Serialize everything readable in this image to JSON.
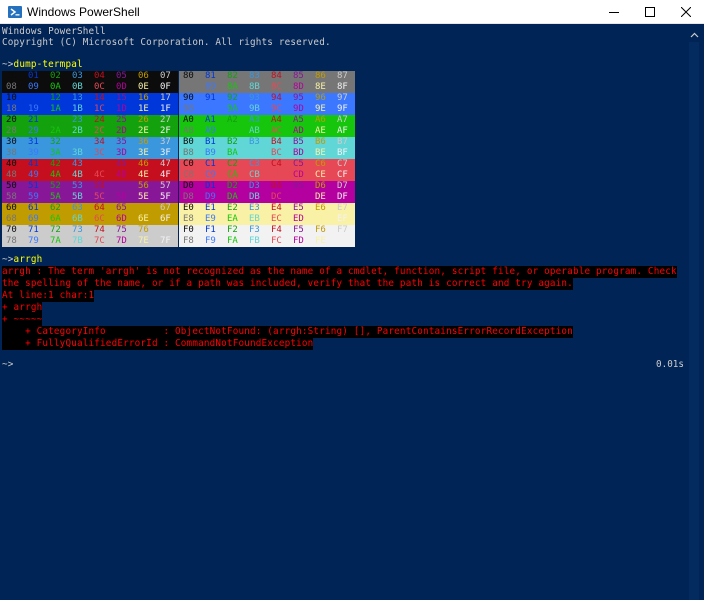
{
  "window": {
    "title": "Windows PowerShell",
    "colors": {
      "background": "#012456",
      "text": "#cccccc",
      "prompt_cmd": "#ffff00",
      "error_fg": "#ff0000",
      "error_bg": "#000000"
    }
  },
  "console": {
    "banner": [
      "Windows PowerShell",
      "Copyright (C) Microsoft Corporation. All rights reserved."
    ],
    "prompt1": "~>",
    "command1": "dump-termpal",
    "prompt2": "~>",
    "command2": "arrgh",
    "error_lines": [
      "arrgh : The term 'arrgh' is not recognized as the name of a cmdlet, function, script file, or operable program. Check",
      "the spelling of the name, or if a path was included, verify that the path is correct and try again.",
      "At line:1 char:1",
      "+ arrgh",
      "+ ~~~~~",
      "    + CategoryInfo          : ObjectNotFound: (arrgh:String) [], ParentContainsErrorRecordException",
      "    + FullyQualifiedErrorId : CommandNotFoundException"
    ],
    "prompt3": "~>",
    "timing": "0.01s"
  },
  "palette": {
    "colors": [
      "#0c0c0c",
      "#0037da",
      "#13a10e",
      "#3a96dd",
      "#c50f1f",
      "#881798",
      "#c19c00",
      "#cccccc",
      "#767676",
      "#3b78ff",
      "#16c60c",
      "#61d6d6",
      "#e74856",
      "#b4009e",
      "#f9f1a5",
      "#f2f2f2"
    ],
    "rows": [
      [
        "00",
        "01",
        "02",
        "03",
        "04",
        "05",
        "06",
        "07",
        "80",
        "81",
        "82",
        "83",
        "84",
        "85",
        "86",
        "87"
      ],
      [
        "08",
        "09",
        "0A",
        "0B",
        "0C",
        "0D",
        "0E",
        "0F",
        "88",
        "89",
        "8A",
        "8B",
        "8C",
        "8D",
        "8E",
        "8F"
      ],
      [
        "10",
        "11",
        "12",
        "13",
        "14",
        "15",
        "16",
        "17",
        "90",
        "91",
        "92",
        "93",
        "94",
        "95",
        "96",
        "97"
      ],
      [
        "18",
        "19",
        "1A",
        "1B",
        "1C",
        "1D",
        "1E",
        "1F",
        "98",
        "99",
        "9A",
        "9B",
        "9C",
        "9D",
        "9E",
        "9F"
      ],
      [
        "20",
        "21",
        "22",
        "23",
        "24",
        "25",
        "26",
        "27",
        "A0",
        "A1",
        "A2",
        "A3",
        "A4",
        "A5",
        "A6",
        "A7"
      ],
      [
        "28",
        "29",
        "2A",
        "2B",
        "2C",
        "2D",
        "2E",
        "2F",
        "A8",
        "A9",
        "AA",
        "AB",
        "AC",
        "AD",
        "AE",
        "AF"
      ],
      [
        "30",
        "31",
        "32",
        "33",
        "34",
        "35",
        "36",
        "37",
        "B0",
        "B1",
        "B2",
        "B3",
        "B4",
        "B5",
        "B6",
        "B7"
      ],
      [
        "38",
        "39",
        "3A",
        "3B",
        "3C",
        "3D",
        "3E",
        "3F",
        "B8",
        "B9",
        "BA",
        "BB",
        "BC",
        "BD",
        "BE",
        "BF"
      ],
      [
        "40",
        "41",
        "42",
        "43",
        "44",
        "45",
        "46",
        "47",
        "C0",
        "C1",
        "C2",
        "C3",
        "C4",
        "C5",
        "C6",
        "C7"
      ],
      [
        "48",
        "49",
        "4A",
        "4B",
        "4C",
        "4D",
        "4E",
        "4F",
        "C8",
        "C9",
        "CA",
        "CB",
        "CC",
        "CD",
        "CE",
        "CF"
      ],
      [
        "50",
        "51",
        "52",
        "53",
        "54",
        "55",
        "56",
        "57",
        "D0",
        "D1",
        "D2",
        "D3",
        "D4",
        "D5",
        "D6",
        "D7"
      ],
      [
        "58",
        "59",
        "5A",
        "5B",
        "5C",
        "5D",
        "5E",
        "5F",
        "D8",
        "D9",
        "DA",
        "DB",
        "DC",
        "DD",
        "DE",
        "DF"
      ],
      [
        "60",
        "61",
        "62",
        "63",
        "64",
        "65",
        "66",
        "67",
        "E0",
        "E1",
        "E2",
        "E3",
        "E4",
        "E5",
        "E6",
        "E7"
      ],
      [
        "68",
        "69",
        "6A",
        "6B",
        "6C",
        "6D",
        "6E",
        "6F",
        "E8",
        "E9",
        "EA",
        "EB",
        "EC",
        "ED",
        "EE",
        "EF"
      ],
      [
        "70",
        "71",
        "72",
        "73",
        "74",
        "75",
        "76",
        "77",
        "F0",
        "F1",
        "F2",
        "F3",
        "F4",
        "F5",
        "F6",
        "F7"
      ],
      [
        "78",
        "79",
        "7A",
        "7B",
        "7C",
        "7D",
        "7E",
        "7F",
        "F8",
        "F9",
        "FA",
        "FB",
        "FC",
        "FD",
        "FE",
        "FF"
      ]
    ]
  },
  "icons": {
    "app": "powershell-icon",
    "minimize": "minimize-icon",
    "maximize": "maximize-icon",
    "close": "close-icon",
    "scroll_up": "scroll-up-arrow-icon"
  }
}
